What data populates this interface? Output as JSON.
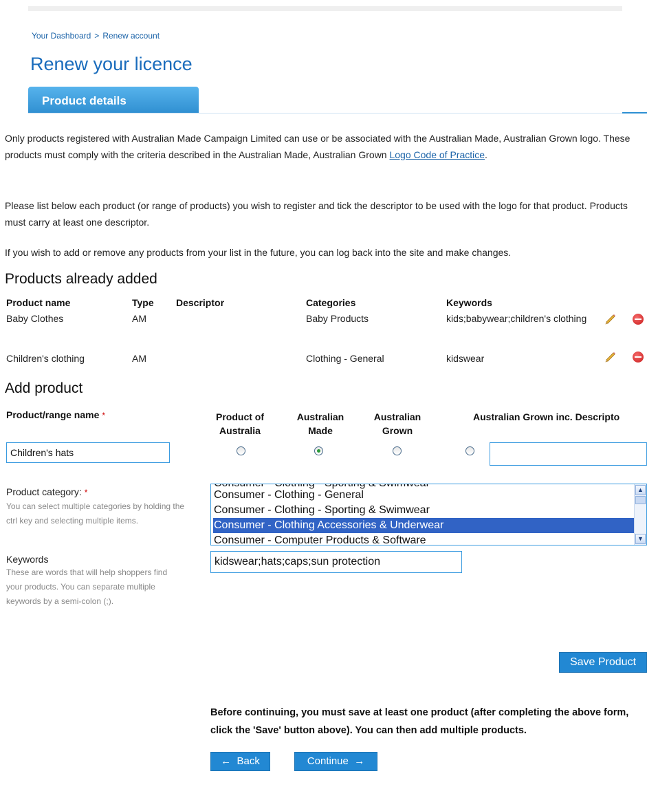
{
  "breadcrumb": {
    "dashboard": "Your Dashboard",
    "separator": ">",
    "current": "Renew account"
  },
  "page_title": "Renew your licence",
  "tab": {
    "label": "Product details"
  },
  "intro": {
    "p1_text": "Only products registered with Australian Made Campaign Limited can use or be associated with the Australian Made, Australian Grown logo. These products must comply with the criteria described in the Australian Made, Australian Grown",
    "p1_link": "Logo Code of Practice",
    "p1_end": ".",
    "p2": "Please list below each product (or range of products) you wish to register and tick the descriptor to be used with the logo for that product. Products must carry at least one descriptor.",
    "p3": "If you wish to add or remove any products from your list in the future, you can log back into the site and make changes."
  },
  "products_added": {
    "title": "Products already added",
    "headers": {
      "name": "Product name",
      "type": "Type",
      "descriptor": "Descriptor",
      "categories": "Categories",
      "keywords": "Keywords"
    },
    "rows": [
      {
        "name": "Baby Clothes",
        "type": "AM",
        "descriptor": "",
        "categories": "Baby Products",
        "keywords": "kids;babywear;children's clothing",
        "edit_icon": "pencil-icon",
        "delete_icon": "minus-circle-icon"
      },
      {
        "name": "Children's clothing",
        "type": "AM",
        "descriptor": "",
        "categories": "Clothing - General",
        "keywords": "kidswear",
        "edit_icon": "pencil-icon",
        "delete_icon": "minus-circle-icon"
      }
    ]
  },
  "add_product": {
    "title": "Add product",
    "name_label": "Product/range name",
    "required_mark": "*",
    "name_value": "Children's hats",
    "descriptors": {
      "product_of_australia": "Product of Australia",
      "australian_made": "Australian Made",
      "australian_grown": "Australian Grown",
      "australian_grown_inc": "Australian Grown inc. Descripto"
    },
    "selected_descriptor": "Australian Made",
    "category_label": "Product category:",
    "category_help": "You can select multiple categories by holding the ctrl key and selecting multiple items.",
    "category_options": [
      "Consumer - Clothing - General",
      "Consumer - Clothing - Sporting & Swimwear",
      "Consumer - Clothing Accessories & Underwear",
      "Consumer - Computer Products & Software"
    ],
    "category_selected": "Consumer - Clothing Accessories & Underwear",
    "keywords_label": "Keywords",
    "keywords_help": "These are words that will help shoppers find your products. You can separate multiple keywords by a semi-colon (;).",
    "keywords_value": "kidswear;hats;caps;sun protection",
    "save_button": "Save Product"
  },
  "footer": {
    "notice": "Before continuing, you must save at least one product (after completing the above form, click the 'Save' button above). You can then add multiple products.",
    "back_button": "Back",
    "continue_button": "Continue"
  },
  "colors": {
    "accent": "#2288d3",
    "title": "#1a6cbc",
    "link": "#1b63a8",
    "selection": "#3163c5",
    "required": "#cc0000"
  }
}
